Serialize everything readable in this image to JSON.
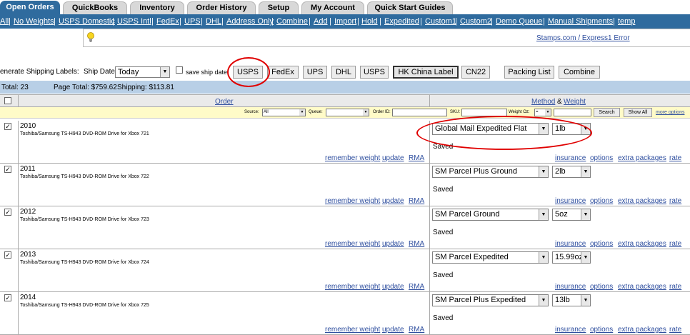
{
  "tabs": [
    {
      "label": "Open Orders",
      "active": true
    },
    {
      "label": "QuickBooks"
    },
    {
      "label": "Inventory"
    },
    {
      "label": "Order History"
    },
    {
      "label": "Setup"
    },
    {
      "label": "My Account"
    },
    {
      "label": "Quick Start Guides"
    }
  ],
  "filters": [
    "All",
    "No Weights",
    "USPS Domestic",
    "USPS Intl",
    "FedEx",
    "UPS",
    "DHL",
    "Address Only",
    "Combine",
    "Add",
    "Import",
    "Hold",
    "Expedited",
    "Custom1",
    "Custom2",
    "Demo Queue",
    "Manual Shipments",
    "temp"
  ],
  "message": {
    "error_link": "Stamps.com / Express1 Error"
  },
  "shipping": {
    "label": "enerate Shipping Labels:",
    "ship_date_label": "Ship Date",
    "ship_date_value": "Today",
    "save_ship_date": "save ship date",
    "buttons": [
      "USPS",
      "FedEx",
      "UPS",
      "DHL",
      "USPS",
      "HK China Label",
      "CN22",
      "Packing List",
      "Combine"
    ]
  },
  "totals": {
    "total": "Total:  23",
    "page_total": "Page Total:  $759.62",
    "shipping": "Shipping:  $113.81"
  },
  "header": {
    "order": "Order",
    "method": "Method",
    "amp": "&",
    "weight": "Weight"
  },
  "search": {
    "source_label": "Source:",
    "source_value": "All",
    "queue_label": "Queue:",
    "order_id_label": "Order ID:",
    "sku_label": "SKU:",
    "weight_label": "Weight Oz:",
    "weight_op": "=",
    "search_btn": "Search",
    "show_all_btn": "Show All",
    "more_options": "more options"
  },
  "row_links": {
    "remember_weight": "remember weight",
    "update": "update",
    "rma": "RMA",
    "insurance": "insurance",
    "options": "options",
    "extra_packages": "extra packages",
    "rate": "rate",
    "saved": "Saved"
  },
  "orders": [
    {
      "id": "2010",
      "desc": "Toshiba/Samsung TS-H943 DVD-ROM Drive for Xbox 721",
      "method": "Global Mail Expedited Flat",
      "weight": "1lb",
      "checked": true
    },
    {
      "id": "2011",
      "desc": "Toshiba/Samsung TS-H943 DVD-ROM Drive for Xbox 722",
      "method": "SM Parcel Plus Ground",
      "weight": "2lb",
      "checked": true
    },
    {
      "id": "2012",
      "desc": "Toshiba/Samsung TS-H943 DVD-ROM Drive for Xbox 723",
      "method": "SM Parcel Ground",
      "weight": "5oz",
      "checked": true
    },
    {
      "id": "2013",
      "desc": "Toshiba/Samsung TS-H943 DVD-ROM Drive for Xbox 724",
      "method": "SM Parcel Expedited",
      "weight": "15.99oz",
      "checked": true
    },
    {
      "id": "2014",
      "desc": "Toshiba/Samsung TS-H943 DVD-ROM Drive for Xbox 725",
      "method": "SM Parcel Plus Expedited",
      "weight": "13lb",
      "checked": true
    }
  ],
  "colors": {
    "nav_blue": "#2f6b9e",
    "totals_blue": "#b8cfe6",
    "search_yellow": "#fffbc8",
    "annotation_red": "#e00000"
  }
}
